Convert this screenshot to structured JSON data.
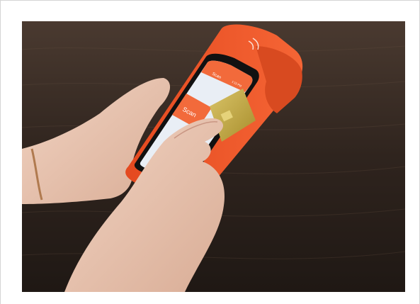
{
  "photo": {
    "screen_title": "Scan",
    "scan_button_label": "Scan",
    "status_time": "1:13 PM",
    "colors": {
      "device": "#f0572a",
      "device_dark": "#c9401b",
      "screen_header": "#f26a3b",
      "screen_bg": "#e9eef5",
      "scan_tile": "#f26a3b",
      "card_gold": "#c8b04a",
      "table_wood": "#3a2c24",
      "skin": "#e8c6b3"
    }
  }
}
